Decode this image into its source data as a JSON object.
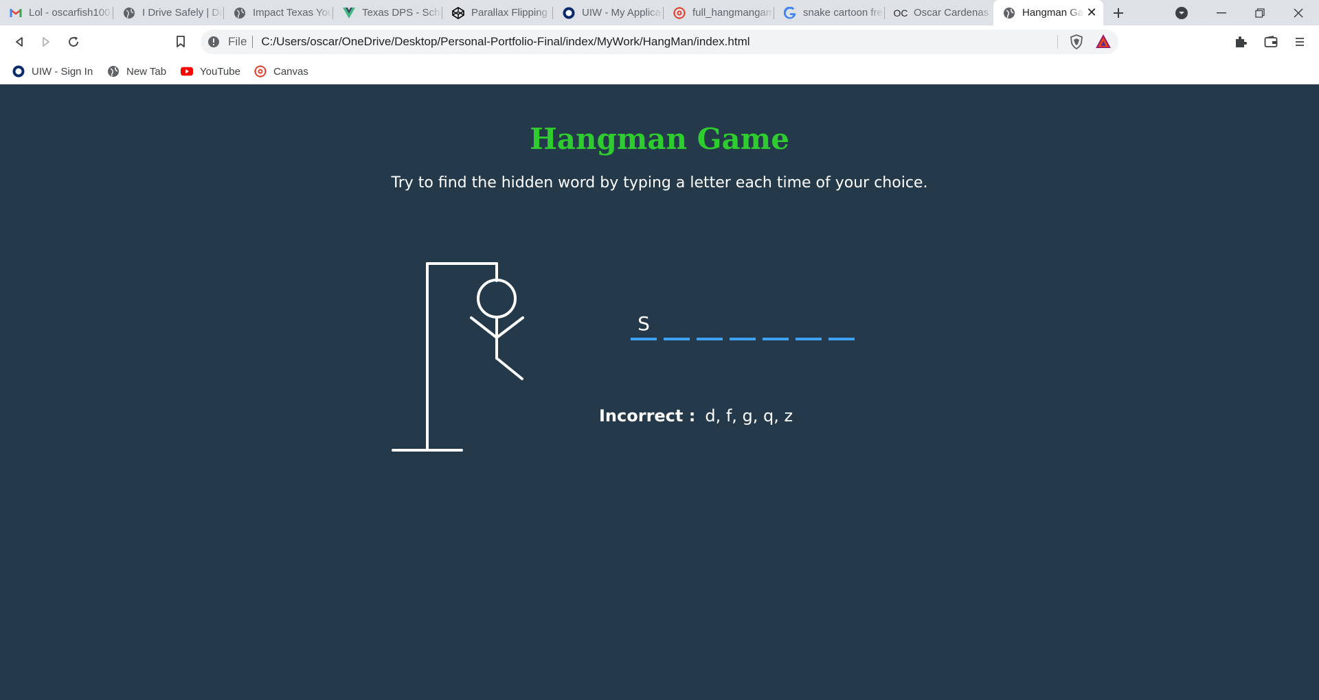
{
  "browser": {
    "tabs": [
      {
        "label": "Lol - oscarfish100",
        "icon": "gmail-icon"
      },
      {
        "label": "I Drive Safely | Da",
        "icon": "globe-icon"
      },
      {
        "label": "Impact Texas You",
        "icon": "globe-icon"
      },
      {
        "label": "Texas DPS - Sche",
        "icon": "vue-icon"
      },
      {
        "label": "Parallax Flipping",
        "icon": "codepen-icon"
      },
      {
        "label": "UIW - My Applica",
        "icon": "uiw-icon"
      },
      {
        "label": "full_hangmangam",
        "icon": "canvas-icon"
      },
      {
        "label": "snake cartoon fre",
        "icon": "google-icon"
      },
      {
        "label": "Oscar Cardenas",
        "icon": "oc-icon"
      },
      {
        "label": "Hangman Ga",
        "icon": "globe-icon",
        "active": true
      }
    ],
    "address": {
      "scheme": "File",
      "url": "C:/Users/oscar/OneDrive/Desktop/Personal-Portfolio-Final/index/MyWork/HangMan/index.html"
    },
    "bookmarks": [
      {
        "label": "UIW - Sign In",
        "icon": "uiw-icon"
      },
      {
        "label": "New Tab",
        "icon": "globe-icon"
      },
      {
        "label": "YouTube",
        "icon": "youtube-icon"
      },
      {
        "label": "Canvas",
        "icon": "canvas-icon"
      }
    ]
  },
  "game": {
    "title": "Hangman Game",
    "subtitle": "Try to find the hidden word by typing a letter each time of your choice.",
    "word_slots": [
      "S",
      "",
      "",
      "",
      "",
      "",
      ""
    ],
    "incorrect_label": "Incorrect :",
    "incorrect_letters": "d, f, g, q, z",
    "colors": {
      "title": "#2ecc2e",
      "slot_underline": "#3ea1f1",
      "background": "#243a4b"
    }
  }
}
